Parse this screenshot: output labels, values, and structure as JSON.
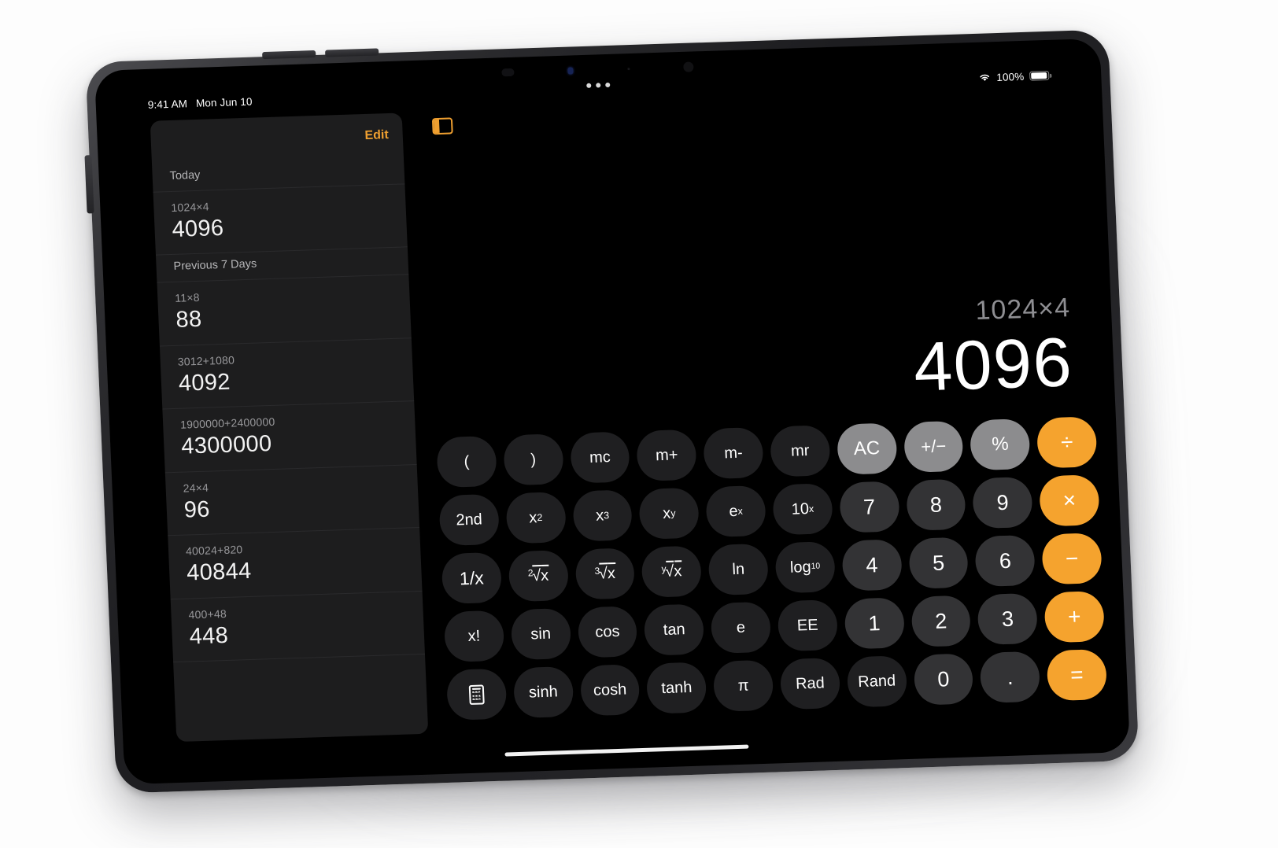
{
  "status_bar": {
    "time": "9:41 AM",
    "date": "Mon Jun 10",
    "battery_percent": "100%",
    "wifi_icon": "wifi-icon",
    "battery_icon": "battery-icon"
  },
  "sidebar": {
    "edit_label": "Edit",
    "sections": [
      {
        "header": "Today",
        "items": [
          {
            "expression": "1024×4",
            "result": "4096"
          }
        ]
      },
      {
        "header": "Previous 7 Days",
        "items": [
          {
            "expression": "11×8",
            "result": "88"
          },
          {
            "expression": "3012+1080",
            "result": "4092"
          },
          {
            "expression": "1900000+2400000",
            "result": "4300000"
          },
          {
            "expression": "24×4",
            "result": "96"
          },
          {
            "expression": "40024+820",
            "result": "40844"
          },
          {
            "expression": "400+48",
            "result": "448"
          }
        ]
      }
    ]
  },
  "toolbar": {
    "sidebar_toggle_icon": "sidebar-toggle-icon",
    "multitask_handle": "•••"
  },
  "display": {
    "expression": "1024×4",
    "result": "4096"
  },
  "keypad": {
    "rows": [
      [
        {
          "label": "(",
          "type": "fn",
          "name": "open-paren"
        },
        {
          "label": ")",
          "type": "fn",
          "name": "close-paren"
        },
        {
          "label": "mc",
          "type": "fn",
          "name": "memory-clear"
        },
        {
          "label": "m+",
          "type": "fn",
          "name": "memory-add"
        },
        {
          "label": "m-",
          "type": "fn",
          "name": "memory-subtract"
        },
        {
          "label": "mr",
          "type": "fn",
          "name": "memory-recall"
        },
        {
          "label": "AC",
          "type": "util",
          "name": "all-clear"
        },
        {
          "label": "⁺⁄₋",
          "type": "util",
          "name": "sign-toggle"
        },
        {
          "label": "%",
          "type": "util",
          "name": "percent"
        },
        {
          "label": "÷",
          "type": "op",
          "name": "divide"
        }
      ],
      [
        {
          "label": "2nd",
          "type": "fn",
          "name": "second-functions"
        },
        {
          "label": "x²",
          "type": "fn",
          "name": "x-squared"
        },
        {
          "label": "x³",
          "type": "fn",
          "name": "x-cubed"
        },
        {
          "label": "xʸ",
          "type": "fn",
          "name": "x-to-the-y"
        },
        {
          "label": "eˣ",
          "type": "fn",
          "name": "e-to-the-x"
        },
        {
          "label": "10ˣ",
          "type": "fn",
          "name": "ten-to-the-x"
        },
        {
          "label": "7",
          "type": "digit",
          "name": "digit-7"
        },
        {
          "label": "8",
          "type": "digit",
          "name": "digit-8"
        },
        {
          "label": "9",
          "type": "digit",
          "name": "digit-9"
        },
        {
          "label": "×",
          "type": "op",
          "name": "multiply"
        }
      ],
      [
        {
          "label": "⅐",
          "type": "fn",
          "name": "reciprocal"
        },
        {
          "label": "²√x",
          "type": "fn",
          "name": "square-root"
        },
        {
          "label": "³√x",
          "type": "fn",
          "name": "cube-root"
        },
        {
          "label": "ʸ√x",
          "type": "fn",
          "name": "nth-root"
        },
        {
          "label": "ln",
          "type": "fn",
          "name": "natural-log"
        },
        {
          "label": "log₁₀",
          "type": "fn",
          "name": "log-base-10"
        },
        {
          "label": "4",
          "type": "digit",
          "name": "digit-4"
        },
        {
          "label": "5",
          "type": "digit",
          "name": "digit-5"
        },
        {
          "label": "6",
          "type": "digit",
          "name": "digit-6"
        },
        {
          "label": "−",
          "type": "op",
          "name": "subtract"
        }
      ],
      [
        {
          "label": "x!",
          "type": "fn",
          "name": "factorial"
        },
        {
          "label": "sin",
          "type": "fn",
          "name": "sine"
        },
        {
          "label": "cos",
          "type": "fn",
          "name": "cosine"
        },
        {
          "label": "tan",
          "type": "fn",
          "name": "tangent"
        },
        {
          "label": "e",
          "type": "fn",
          "name": "eulers-number"
        },
        {
          "label": "EE",
          "type": "fn",
          "name": "exponent-entry"
        },
        {
          "label": "1",
          "type": "digit",
          "name": "digit-1"
        },
        {
          "label": "2",
          "type": "digit",
          "name": "digit-2"
        },
        {
          "label": "3",
          "type": "digit",
          "name": "digit-3"
        },
        {
          "label": "+",
          "type": "op",
          "name": "add"
        }
      ],
      [
        {
          "label": "",
          "type": "fn",
          "name": "calculator-mode-icon"
        },
        {
          "label": "sinh",
          "type": "fn",
          "name": "hyperbolic-sine"
        },
        {
          "label": "cosh",
          "type": "fn",
          "name": "hyperbolic-cosine"
        },
        {
          "label": "tanh",
          "type": "fn",
          "name": "hyperbolic-tangent"
        },
        {
          "label": "π",
          "type": "fn",
          "name": "pi"
        },
        {
          "label": "Rad",
          "type": "fn",
          "name": "radians-toggle"
        },
        {
          "label": "Rand",
          "type": "fn",
          "name": "random"
        },
        {
          "label": "0",
          "type": "digit",
          "name": "digit-0"
        },
        {
          "label": ".",
          "type": "digit",
          "name": "decimal-point"
        },
        {
          "label": "=",
          "type": "op",
          "name": "equals"
        }
      ]
    ]
  },
  "colors": {
    "accent_orange": "#f5a32e",
    "edit_orange": "#f0a030",
    "util_gray": "#8c8c8e",
    "digit_gray": "#333335",
    "function_gray": "#1f1f21",
    "sidebar_bg": "#1d1d1e",
    "screen_bg": "#000000"
  }
}
